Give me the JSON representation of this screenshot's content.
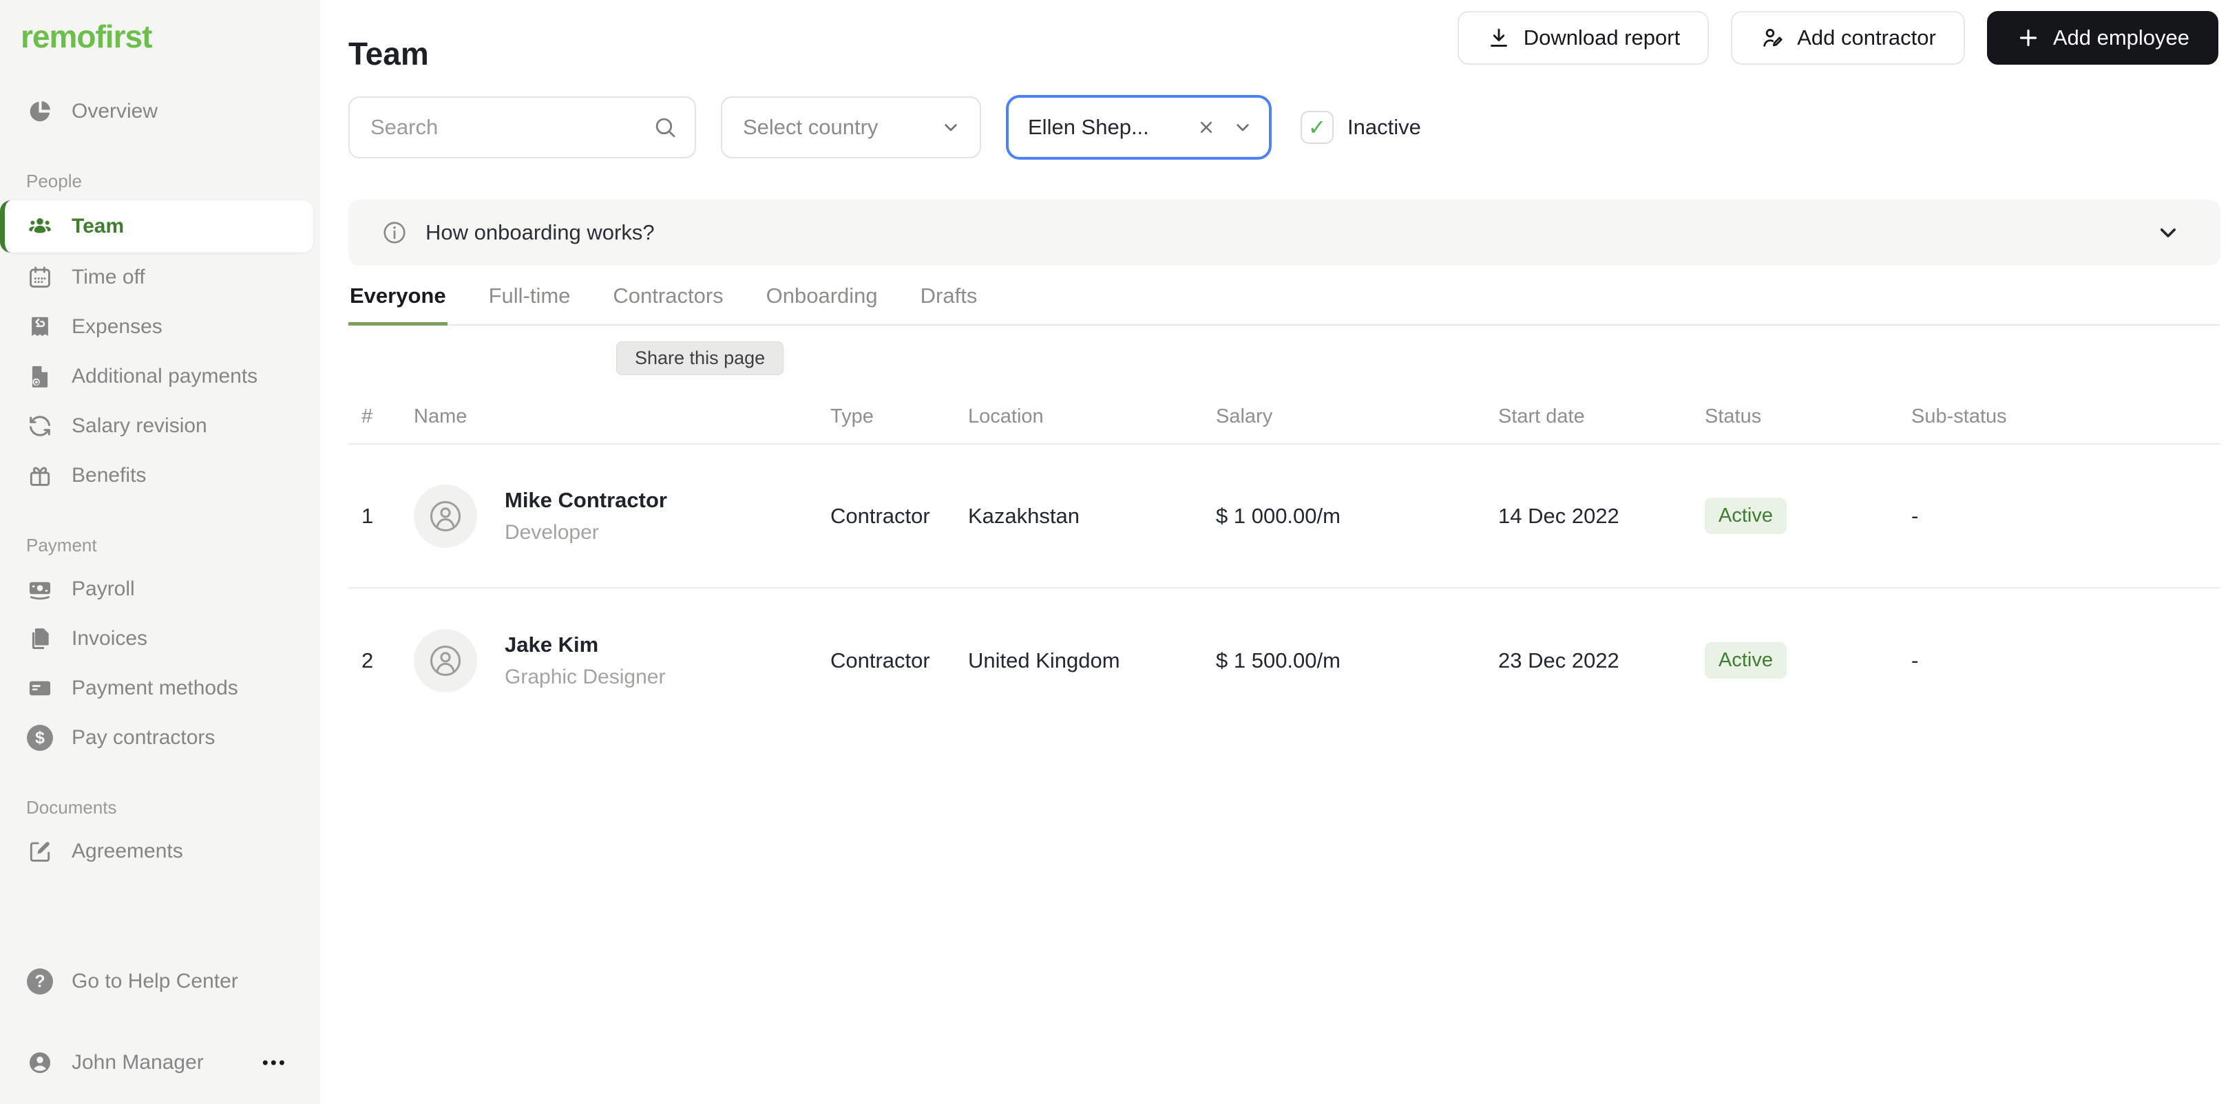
{
  "colors": {
    "brand_green": "#6cbf4b",
    "active_nav_green": "#3e7e2d",
    "tab_underline_green": "#7ba05b",
    "focus_blue": "#4d82f3",
    "status_active_bg": "#e9f2e5",
    "status_active_text": "#3e7d33",
    "sidebar_bg": "#f5f5f3",
    "dark_button_bg": "#141619"
  },
  "brand": {
    "name": "remofirst"
  },
  "sidebar": {
    "overview": {
      "label": "Overview",
      "icon": "pie-chart-icon"
    },
    "sections": [
      {
        "label": "People",
        "items": [
          {
            "label": "Team",
            "icon": "users-icon",
            "active": true
          },
          {
            "label": "Time off",
            "icon": "calendar-icon"
          },
          {
            "label": "Expenses",
            "icon": "receipt-icon"
          },
          {
            "label": "Additional payments",
            "icon": "document-payment-icon"
          },
          {
            "label": "Salary revision",
            "icon": "refresh-icon"
          },
          {
            "label": "Benefits",
            "icon": "gift-icon"
          }
        ]
      },
      {
        "label": "Payment",
        "items": [
          {
            "label": "Payroll",
            "icon": "banknote-icon"
          },
          {
            "label": "Invoices",
            "icon": "invoices-icon"
          },
          {
            "label": "Payment methods",
            "icon": "credit-card-icon"
          },
          {
            "label": "Pay contractors",
            "icon": "dollar-circle-icon"
          }
        ]
      },
      {
        "label": "Documents",
        "items": [
          {
            "label": "Agreements",
            "icon": "edit-square-icon"
          }
        ]
      }
    ],
    "footer": {
      "help": {
        "label": "Go to Help Center",
        "icon": "question-circle-icon"
      },
      "user": {
        "label": "John Manager",
        "icon": "user-circle-icon",
        "menu": "•••"
      }
    }
  },
  "header": {
    "title": "Team",
    "buttons": [
      {
        "label": "Download report",
        "icon": "download-icon",
        "style": "light"
      },
      {
        "label": "Add contractor",
        "icon": "user-edit-icon",
        "style": "light"
      },
      {
        "label": "Add employee",
        "icon": "plus-icon",
        "style": "dark"
      }
    ]
  },
  "filters": {
    "search": {
      "placeholder": "Search",
      "icon": "search-icon"
    },
    "country": {
      "placeholder": "Select country",
      "icon": "chevron-down-icon"
    },
    "person": {
      "value": "Ellen Shep...",
      "clear_icon": "close-icon",
      "icon": "chevron-down-icon",
      "focused": true
    },
    "inactive": {
      "label": "Inactive",
      "checked": true,
      "check_glyph": "✓"
    }
  },
  "banner": {
    "text": "How onboarding works?",
    "icon": "info-icon",
    "chevron": "chevron-down-icon"
  },
  "tabs": {
    "items": [
      {
        "label": "Everyone",
        "active": true
      },
      {
        "label": "Full-time"
      },
      {
        "label": "Contractors"
      },
      {
        "label": "Onboarding"
      },
      {
        "label": "Drafts"
      }
    ]
  },
  "tooltip": {
    "text": "Share this page"
  },
  "table": {
    "columns": {
      "num": "#",
      "name": "Name",
      "type": "Type",
      "location": "Location",
      "salary": "Salary",
      "start_date": "Start date",
      "status": "Status",
      "sub_status": "Sub-status"
    },
    "rows": [
      {
        "num": "1",
        "name": "Mike Contractor",
        "role": "Developer",
        "type": "Contractor",
        "location": "Kazakhstan",
        "salary": "$ 1 000.00/m",
        "start_date": "14 Dec 2022",
        "status": "Active",
        "sub_status": "-"
      },
      {
        "num": "2",
        "name": "Jake Kim",
        "role": "Graphic Designer",
        "type": "Contractor",
        "location": "United Kingdom",
        "salary": "$ 1 500.00/m",
        "start_date": "23 Dec 2022",
        "status": "Active",
        "sub_status": "-"
      }
    ]
  }
}
